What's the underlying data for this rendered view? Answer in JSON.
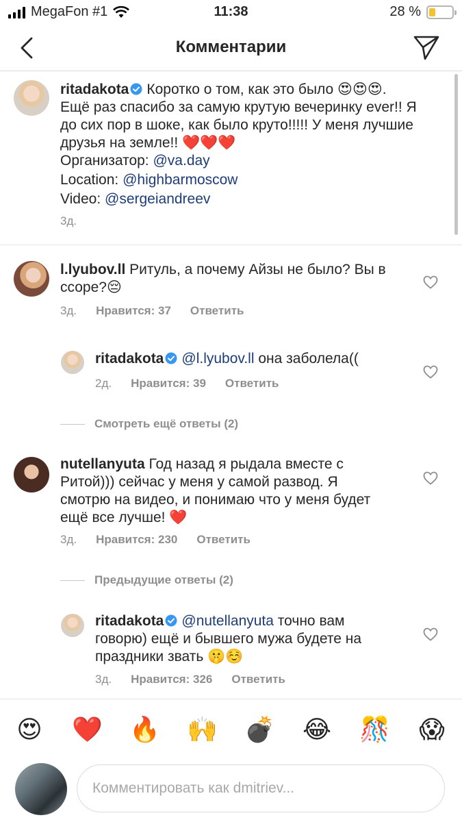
{
  "status": {
    "carrier": "MegaFon #1",
    "time": "11:38",
    "battery": "28 %",
    "battery_level": 0.28
  },
  "header": {
    "title": "Комментарии"
  },
  "caption": {
    "username": "ritadakota",
    "text1": "Коротко о том, как это было 😍😍😍.",
    "text2": "Ещё раз спасибо за самую крутую вечеринку ever!! Я",
    "text3": "до сих пор в шоке, как было круто!!!!! У меня лучшие",
    "text4": "друзья на земле!! ❤️❤️❤️",
    "org_label": "Организатор: ",
    "org_mention": "@va.day",
    "loc_label": "Location: ",
    "loc_mention": "@highbarmoscow",
    "video_label": "Video: ",
    "video_mention": "@sergeiandreev",
    "time": "3д."
  },
  "comments": [
    {
      "username": "l.lyubov.ll",
      "text1": "Ритуль, а почему Айзы не было? Вы в",
      "text2": "ссоре?😔",
      "time": "3д.",
      "likes": "Нравится: 37",
      "reply": "Ответить"
    },
    {
      "username": "ritadakota",
      "mention": "@l.lyubov.ll",
      "text1": " она заболела((",
      "time": "2д.",
      "likes": "Нравится: 39",
      "reply": "Ответить"
    },
    {
      "more": "Смотреть ещё ответы (2)"
    },
    {
      "username": "nutellanyuta",
      "text1": "Год назад я рыдала вместе с",
      "text2": "Ритой))) сейчас у меня у самой развод. Я",
      "text3": "смотрю на видео, и понимаю что у меня будет",
      "text4": "ещё все лучше! ❤️",
      "time": "3д.",
      "likes": "Нравится: 230",
      "reply": "Ответить"
    },
    {
      "more": "Предыдущие ответы (2)"
    },
    {
      "username": "ritadakota",
      "mention": "@nutellanyuta",
      "text1": " точно вам",
      "text2": "говорю) ещё и бывшего мужа будете на",
      "text3": "праздники звать 🤫☺️",
      "time": "3д.",
      "likes": "Нравится: 326",
      "reply": "Ответить"
    }
  ],
  "emoji_bar": [
    "😍",
    "❤️",
    "🔥",
    "🙌",
    "💣",
    "😂",
    "🎊",
    "😱"
  ],
  "input": {
    "placeholder": "Комментировать как dmitriev..."
  },
  "colors": {
    "mention": "#1d3c78",
    "verified": "#3897f0",
    "meta": "#8e8e8e"
  }
}
